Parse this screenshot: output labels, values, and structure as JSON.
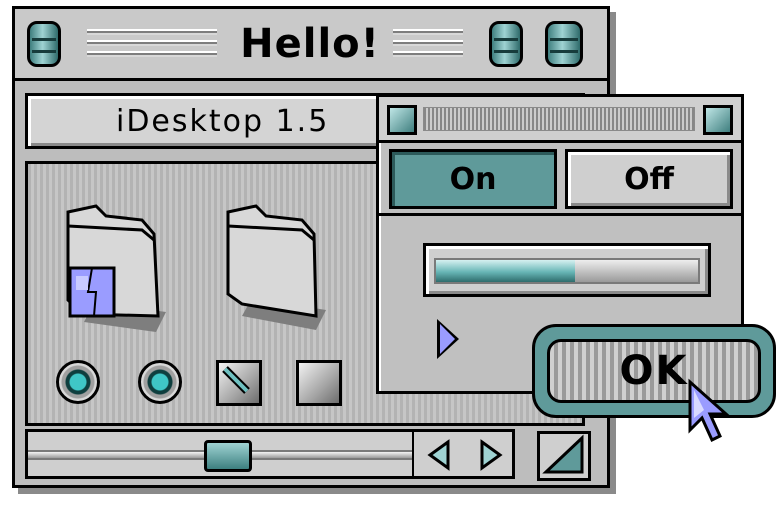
{
  "window": {
    "title": "Hello!",
    "header_label": "iDesktop 1.5"
  },
  "icons": {
    "folder_finder": "folder-with-finder-face-icon",
    "folder_plain": "folder-icon",
    "radio_1": "radio-button-icon",
    "radio_2": "radio-button-icon",
    "pen_button": "pen-button-icon",
    "square_button": "square-button-icon",
    "cursor": "arrow-cursor-icon"
  },
  "dialog": {
    "tabs": [
      {
        "label": "On",
        "active": true
      },
      {
        "label": "Off",
        "active": false
      }
    ],
    "slider_level_percent": 53,
    "ok_label": "OK"
  },
  "colors": {
    "accent_teal": "#5f9a9a",
    "chrome_gray": "#bdbdbd",
    "highlight_blue": "#9a9cff"
  }
}
